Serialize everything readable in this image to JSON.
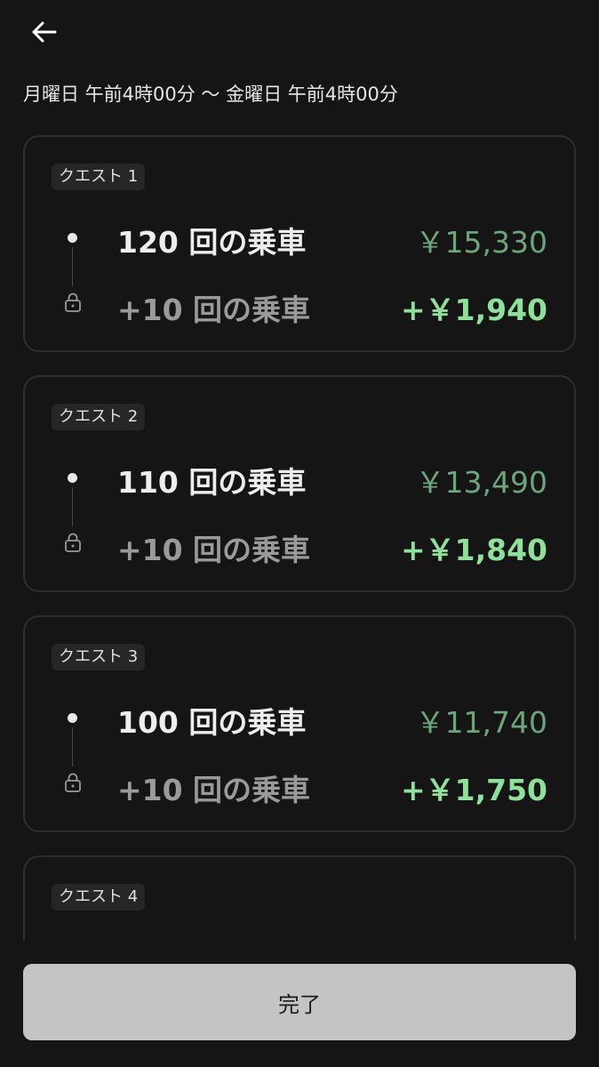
{
  "header": {
    "back_icon": "arrow-left-icon",
    "period": "月曜日 午前4時00分 〜 金曜日 午前4時00分"
  },
  "quests": [
    {
      "label": "クエスト 1",
      "main_rides": "120 回の乗車",
      "main_fare": "￥15,330",
      "bonus_rides": "+10 回の乗車",
      "bonus_fare": "+￥1,940"
    },
    {
      "label": "クエスト 2",
      "main_rides": "110 回の乗車",
      "main_fare": "￥13,490",
      "bonus_rides": "+10 回の乗車",
      "bonus_fare": "+￥1,840"
    },
    {
      "label": "クエスト 3",
      "main_rides": "100 回の乗車",
      "main_fare": "￥11,740",
      "bonus_rides": "+10 回の乗車",
      "bonus_fare": "+￥1,750"
    },
    {
      "label": "クエスト 4"
    }
  ],
  "footer": {
    "done_label": "完了"
  },
  "colors": {
    "background": "#151515",
    "fare": "#6da57a",
    "bonus_fare": "#8fe09a",
    "button": "#c4c4c4"
  }
}
